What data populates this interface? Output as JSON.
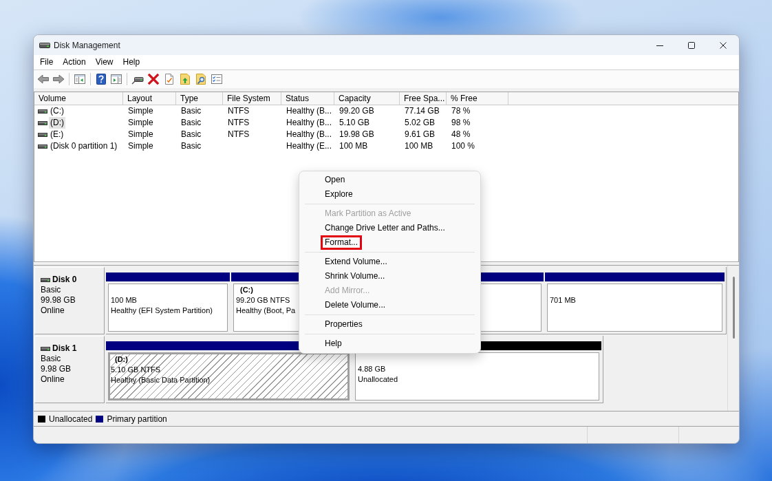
{
  "window": {
    "title": "Disk Management"
  },
  "menu_bar": [
    "File",
    "Action",
    "View",
    "Help"
  ],
  "volume_table": {
    "columns": [
      "Volume",
      "Layout",
      "Type",
      "File System",
      "Status",
      "Capacity",
      "Free Spa...",
      "% Free"
    ],
    "rows": [
      {
        "volume": "(C:)",
        "layout": "Simple",
        "type": "Basic",
        "file_system": "NTFS",
        "status": "Healthy (B...",
        "capacity": "99.20 GB",
        "column_7": "77.14 GB",
        "percent_free": "78 %",
        "selected": false
      },
      {
        "volume": "(D:)",
        "layout": "Simple",
        "type": "Basic",
        "file_system": "NTFS",
        "status": "Healthy (B...",
        "capacity": "5.10 GB",
        "column_7": "5.02 GB",
        "percent_free": "98 %",
        "selected": true
      },
      {
        "volume": "(E:)",
        "layout": "Simple",
        "type": "Basic",
        "file_system": "NTFS",
        "status": "Healthy (B...",
        "capacity": "19.98 GB",
        "column_7": "9.61 GB",
        "percent_free": "48 %",
        "selected": false
      },
      {
        "volume": "(Disk 0 partition 1)",
        "layout": "Simple",
        "type": "Basic",
        "status": "Healthy (E...",
        "capacity": "100 MB",
        "column_7": "100 MB",
        "percent_free": "100 %",
        "selected": false
      }
    ]
  },
  "disks": [
    {
      "name": "Disk 0",
      "type": "Basic",
      "size": "99.98 GB",
      "status": "Online",
      "partitions": [
        {
          "kind": "primary",
          "size": "100 MB",
          "status": "Healthy (EFI System Partition)",
          "selected": false
        },
        {
          "kind": "primary",
          "label": "(C:)",
          "size": "99.20 GB NTFS",
          "status": "Healthy (Boot, Pa",
          "selected": false
        },
        {
          "kind": "primary",
          "size": "701 MB",
          "selected": false
        }
      ]
    },
    {
      "name": "Disk 1",
      "type": "Basic",
      "size": "9.98 GB",
      "status": "Online",
      "partitions": [
        {
          "kind": "primary",
          "label": "(D:)",
          "size": "5.10 GB NTFS",
          "status": "Healthy (Basic Data Partition)",
          "selected": true
        },
        {
          "kind": "unallocated",
          "size": "4.88 GB",
          "status": "Unallocated",
          "selected": false
        }
      ]
    }
  ],
  "legend": [
    {
      "kind": "unallocated",
      "label": "Unallocated",
      "color": "#000000"
    },
    {
      "kind": "primary",
      "label": "Primary partition",
      "color": "#000080"
    }
  ],
  "context_menu": {
    "items": [
      {
        "kind": "item",
        "label": "Open",
        "disabled": false,
        "highlighted": false
      },
      {
        "kind": "item",
        "label": "Explore",
        "disabled": false,
        "highlighted": false
      },
      {
        "kind": "separator"
      },
      {
        "kind": "item",
        "label": "Mark Partition as Active",
        "disabled": true,
        "highlighted": false
      },
      {
        "kind": "item",
        "label": "Change Drive Letter and Paths...",
        "disabled": false,
        "highlighted": false
      },
      {
        "kind": "item",
        "label": "Format...",
        "disabled": false,
        "highlighted": true
      },
      {
        "kind": "separator"
      },
      {
        "kind": "item",
        "label": "Extend Volume...",
        "disabled": false,
        "highlighted": false
      },
      {
        "kind": "item",
        "label": "Shrink Volume...",
        "disabled": false,
        "highlighted": false
      },
      {
        "kind": "item",
        "label": "Add Mirror...",
        "disabled": true,
        "highlighted": false
      },
      {
        "kind": "item",
        "label": "Delete Volume...",
        "disabled": false,
        "highlighted": false
      },
      {
        "kind": "separator"
      },
      {
        "kind": "item",
        "label": "Properties",
        "disabled": false,
        "highlighted": false
      },
      {
        "kind": "separator"
      },
      {
        "kind": "item",
        "label": "Help",
        "disabled": false,
        "highlighted": false
      }
    ]
  }
}
